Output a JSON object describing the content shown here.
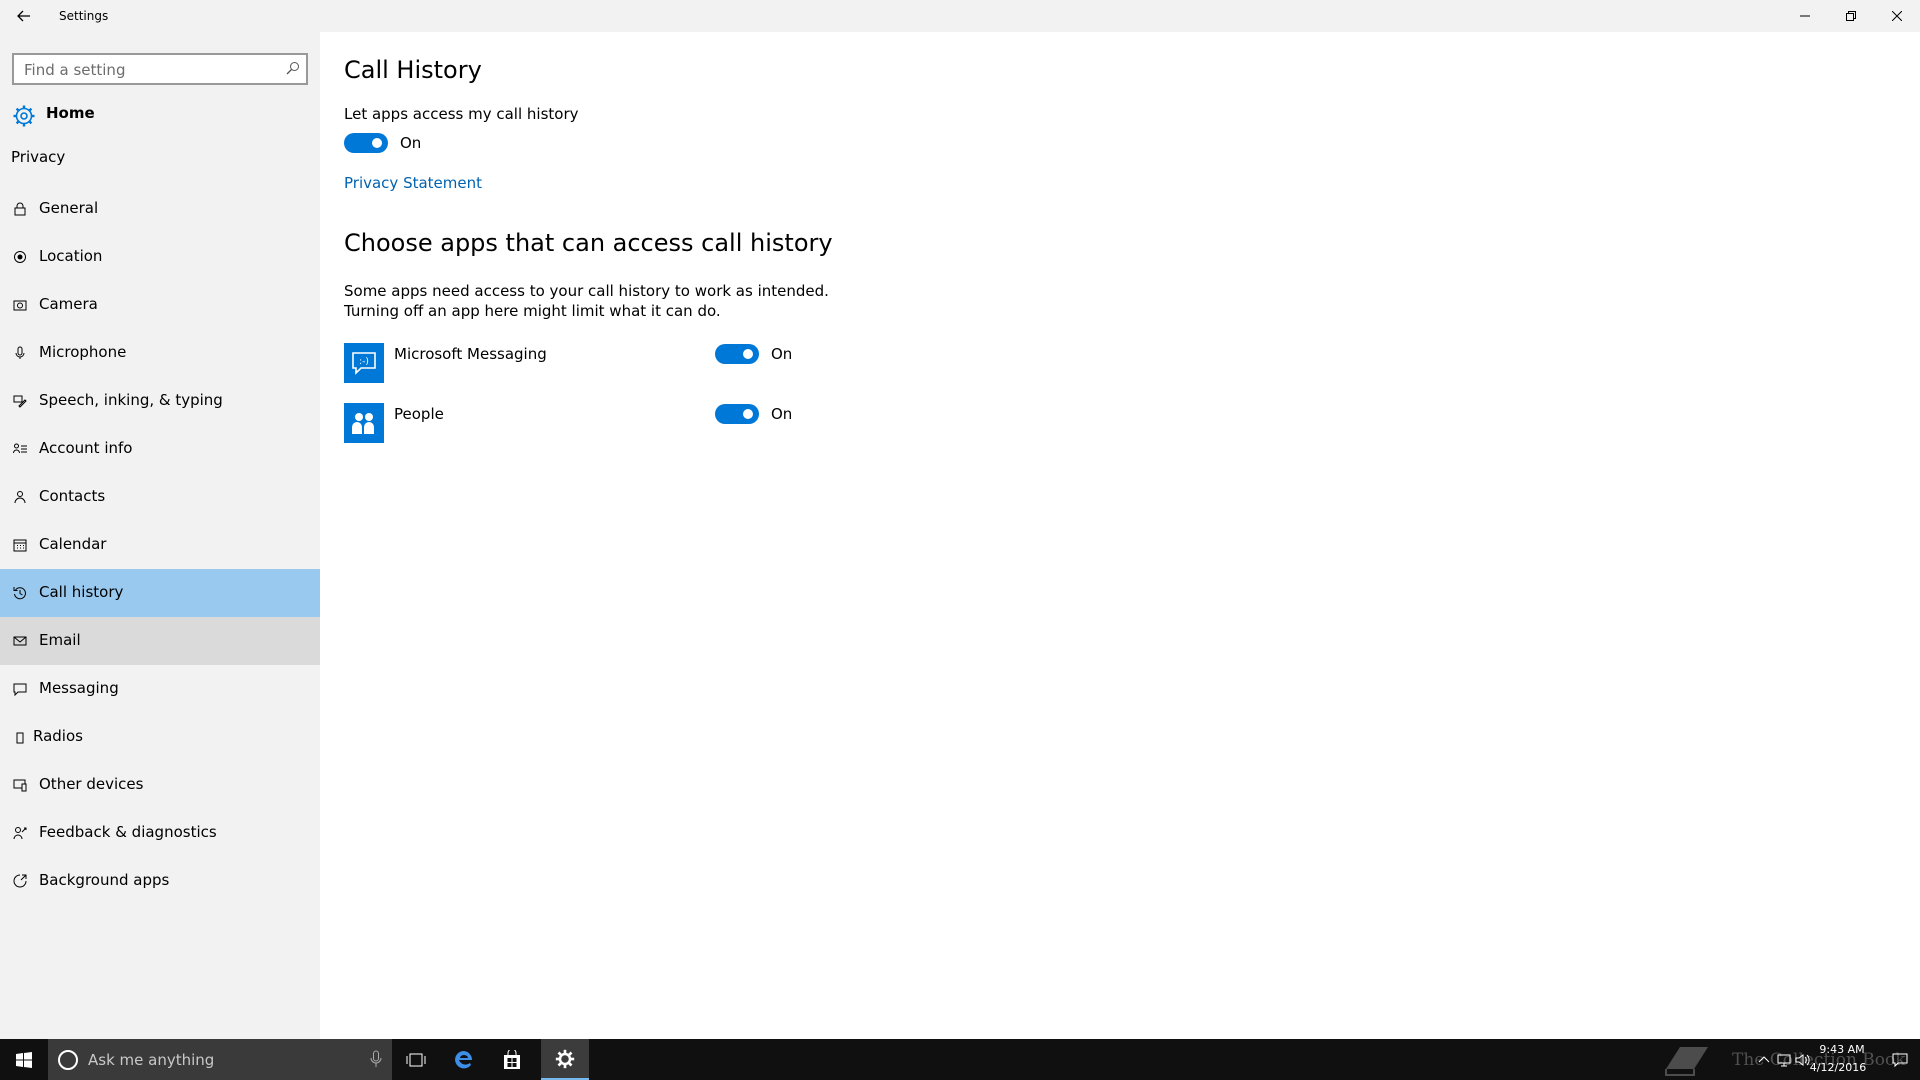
{
  "window": {
    "title": "Settings",
    "back_icon": "arrow-left-icon",
    "controls": [
      "minimize-icon",
      "restore-icon",
      "close-icon"
    ]
  },
  "sidebar": {
    "search_placeholder": "Find a setting",
    "home_label": "Home",
    "section_label": "Privacy",
    "items": [
      {
        "label": "General",
        "icon": "lock-icon"
      },
      {
        "label": "Location",
        "icon": "location-icon"
      },
      {
        "label": "Camera",
        "icon": "camera-icon"
      },
      {
        "label": "Microphone",
        "icon": "microphone-icon"
      },
      {
        "label": "Speech, inking, & typing",
        "icon": "pen-icon"
      },
      {
        "label": "Account info",
        "icon": "account-info-icon"
      },
      {
        "label": "Contacts",
        "icon": "contacts-icon"
      },
      {
        "label": "Calendar",
        "icon": "calendar-icon"
      },
      {
        "label": "Call history",
        "icon": "history-icon",
        "selected": true
      },
      {
        "label": "Email",
        "icon": "mail-icon"
      },
      {
        "label": "Messaging",
        "icon": "message-icon"
      },
      {
        "label": "Radios",
        "icon": "radio-icon"
      },
      {
        "label": "Other devices",
        "icon": "devices-icon"
      },
      {
        "label": "Feedback & diagnostics",
        "icon": "feedback-icon"
      },
      {
        "label": "Background apps",
        "icon": "background-apps-icon"
      }
    ]
  },
  "main": {
    "title": "Call History",
    "master_label": "Let apps access my call history",
    "master_state": "On",
    "privacy_link": "Privacy Statement",
    "apps_heading": "Choose apps that can access call history",
    "apps_desc_line1": "Some apps need access to your call history to work as intended.",
    "apps_desc_line2": "Turning off an app here might limit what it can do.",
    "apps": [
      {
        "name": "Microsoft Messaging",
        "state": "On",
        "icon": "messaging-app-icon"
      },
      {
        "name": "People",
        "state": "On",
        "icon": "people-app-icon"
      }
    ]
  },
  "taskbar": {
    "search_placeholder": "Ask me anything",
    "time": "9:43 AM",
    "date": "4/12/2016",
    "watermark": "The Collection Book",
    "accent": "#0078d7"
  }
}
